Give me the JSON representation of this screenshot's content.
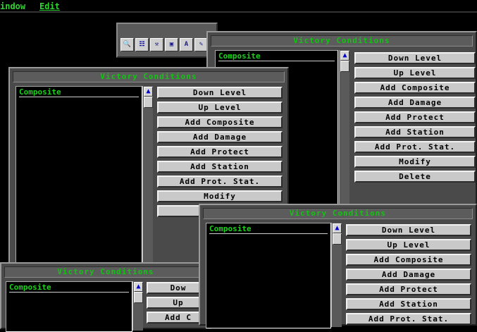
{
  "menubar": {
    "window": "indow",
    "edit": "Edit"
  },
  "toolbar": {
    "icons": [
      "magnifier-icon",
      "grid-icon",
      "wrench-icon",
      "monitor-icon",
      "person-icon",
      "chart-icon"
    ]
  },
  "dialog_title": "Victory Conditions",
  "list_item": "Composite",
  "buttons": [
    "Down Level",
    "Up Level",
    "Add Composite",
    "Add Damage",
    "Add Protect",
    "Add Station",
    "Add Prot. Stat.",
    "Modify",
    "Delete"
  ],
  "partial_buttons": {
    "down": "Dow",
    "up": "Up",
    "add": "Add C"
  }
}
